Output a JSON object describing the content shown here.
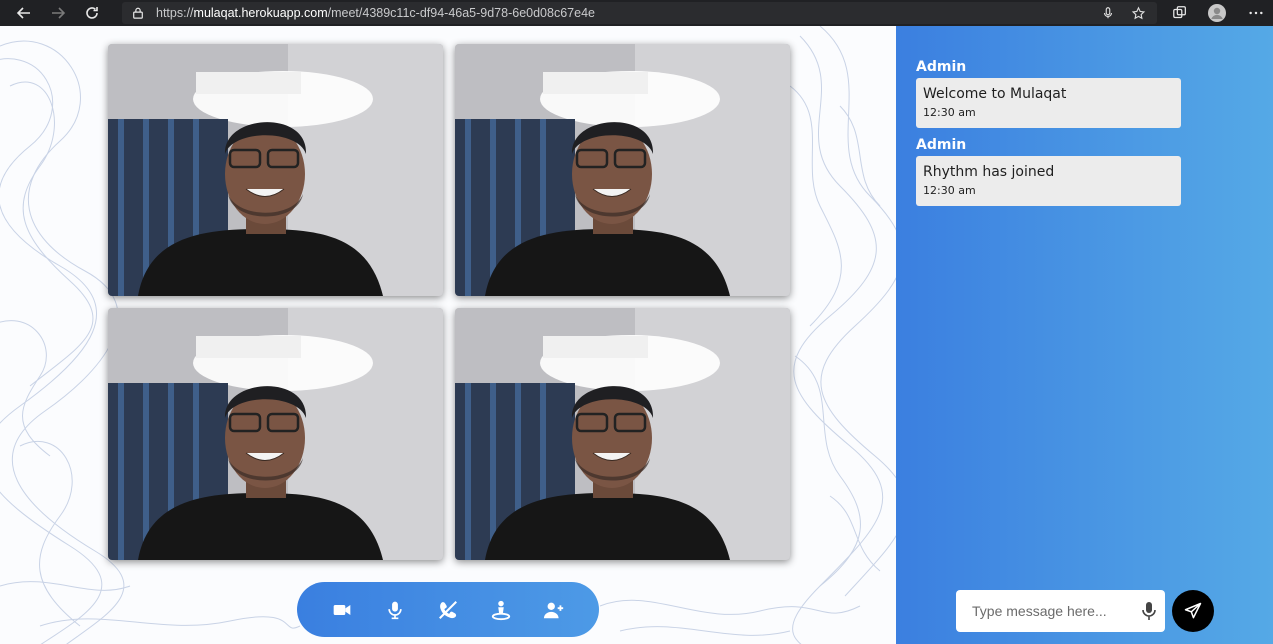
{
  "browser": {
    "url_prefix": "https://",
    "url_host": "mulaqat.herokuapp.com",
    "url_path": "/meet/4389c11c-df94-46a5-9d78-6e0d08c67e4e"
  },
  "video_grid": {
    "tiles": [
      "camera-feed",
      "camera-feed",
      "camera-feed",
      "camera-feed"
    ]
  },
  "controls": {
    "icons": [
      "video-camera-icon",
      "microphone-icon",
      "end-call-icon",
      "share-screen-icon",
      "add-user-icon"
    ],
    "accent": "#3a7fe0"
  },
  "chat": {
    "messages": [
      {
        "sender": "Admin",
        "text": "Welcome to Mulaqat",
        "time": "12:30 am"
      },
      {
        "sender": "Admin",
        "text": "Rhythm has joined",
        "time": "12:30 am"
      }
    ],
    "input_placeholder": "Type message here...",
    "gradient_start": "#3b7fe0",
    "gradient_end": "#55a9e6",
    "send_icon": "send-icon"
  }
}
